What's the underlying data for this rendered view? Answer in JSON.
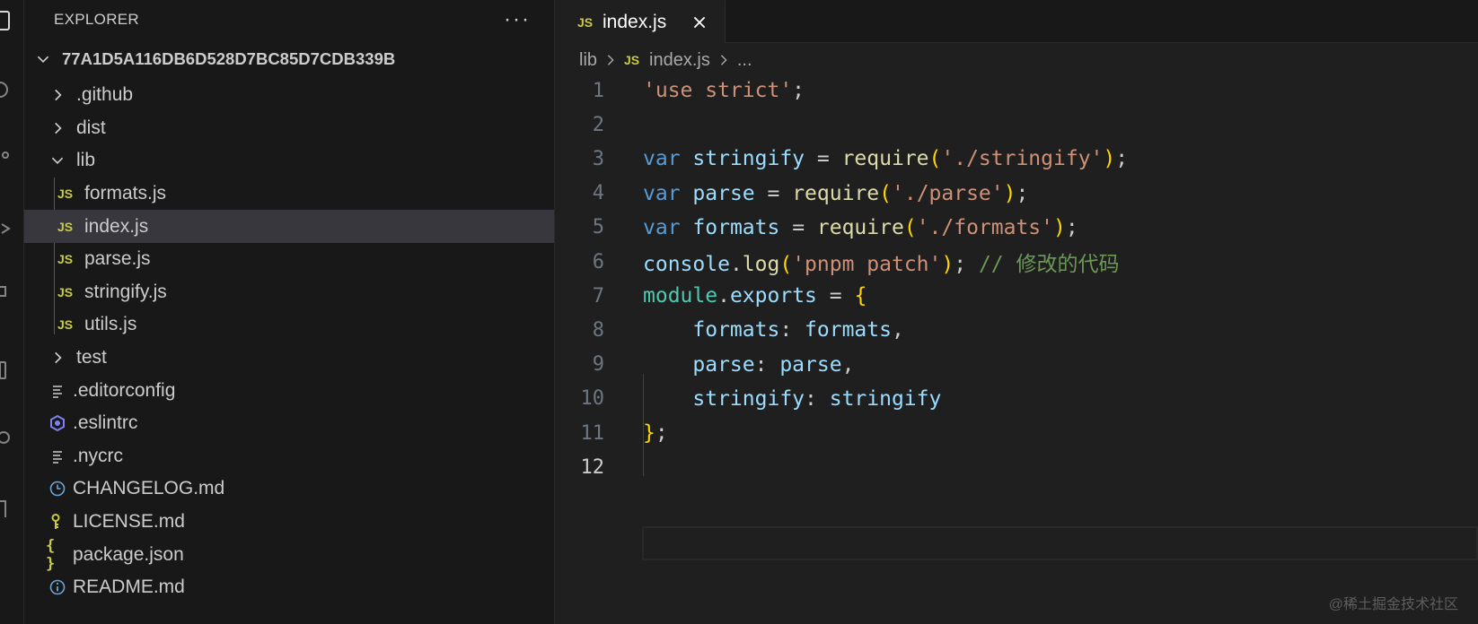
{
  "activity_bar": {
    "icons": [
      "explorer-icon",
      "search-icon",
      "source-control-icon",
      "run-debug-icon",
      "extensions-icon",
      "remote-icon",
      "testing-icon",
      "accounts-icon"
    ]
  },
  "sidebar": {
    "title": "EXPLORER",
    "more_label": "···",
    "root_folder": "77A1D5A116DB6D528D7BC85D7CDB339B",
    "items": [
      {
        "label": ".github",
        "kind": "folder",
        "expanded": false
      },
      {
        "label": "dist",
        "kind": "folder",
        "expanded": false
      },
      {
        "label": "lib",
        "kind": "folder",
        "expanded": true
      },
      {
        "label": "formats.js",
        "kind": "js",
        "js_badge": "JS"
      },
      {
        "label": "index.js",
        "kind": "js",
        "js_badge": "JS",
        "selected": true
      },
      {
        "label": "parse.js",
        "kind": "js",
        "js_badge": "JS"
      },
      {
        "label": "stringify.js",
        "kind": "js",
        "js_badge": "JS"
      },
      {
        "label": "utils.js",
        "kind": "js",
        "js_badge": "JS"
      },
      {
        "label": "test",
        "kind": "folder",
        "expanded": false
      },
      {
        "label": ".editorconfig",
        "kind": "lines-icon"
      },
      {
        "label": ".eslintrc",
        "kind": "eslint-icon"
      },
      {
        "label": ".nycrc",
        "kind": "lines-icon"
      },
      {
        "label": "CHANGELOG.md",
        "kind": "clock-icon"
      },
      {
        "label": "LICENSE.md",
        "kind": "key-icon"
      },
      {
        "label": "package.json",
        "kind": "json-icon",
        "badge": "{ }"
      },
      {
        "label": "README.md",
        "kind": "info-icon"
      }
    ]
  },
  "tab": {
    "js_badge": "JS",
    "label": "index.js"
  },
  "breadcrumb": {
    "folder": "lib",
    "js_badge": "JS",
    "file": "index.js",
    "more": "..."
  },
  "editor": {
    "line_numbers": [
      "1",
      "2",
      "3",
      "4",
      "5",
      "6",
      "7",
      "8",
      "9",
      "10",
      "11",
      "12"
    ],
    "active_line": "12",
    "lines": [
      [
        {
          "t": "'use strict'",
          "c": "str"
        },
        {
          "t": ";",
          "c": "pun"
        }
      ],
      [],
      [
        {
          "t": "var",
          "c": "kw"
        },
        {
          "t": " ",
          "c": "pun"
        },
        {
          "t": "stringify",
          "c": "var"
        },
        {
          "t": " = ",
          "c": "pun"
        },
        {
          "t": "require",
          "c": "fn"
        },
        {
          "t": "(",
          "c": "brk"
        },
        {
          "t": "'./stringify'",
          "c": "str"
        },
        {
          "t": ")",
          "c": "brk"
        },
        {
          "t": ";",
          "c": "pun"
        }
      ],
      [
        {
          "t": "var",
          "c": "kw"
        },
        {
          "t": " ",
          "c": "pun"
        },
        {
          "t": "parse",
          "c": "var"
        },
        {
          "t": " = ",
          "c": "pun"
        },
        {
          "t": "require",
          "c": "fn"
        },
        {
          "t": "(",
          "c": "brk"
        },
        {
          "t": "'./parse'",
          "c": "str"
        },
        {
          "t": ")",
          "c": "brk"
        },
        {
          "t": ";",
          "c": "pun"
        }
      ],
      [
        {
          "t": "var",
          "c": "kw"
        },
        {
          "t": " ",
          "c": "pun"
        },
        {
          "t": "formats",
          "c": "var"
        },
        {
          "t": " = ",
          "c": "pun"
        },
        {
          "t": "require",
          "c": "fn"
        },
        {
          "t": "(",
          "c": "brk"
        },
        {
          "t": "'./formats'",
          "c": "str"
        },
        {
          "t": ")",
          "c": "brk"
        },
        {
          "t": ";",
          "c": "pun"
        }
      ],
      [
        {
          "t": "console",
          "c": "var"
        },
        {
          "t": ".",
          "c": "pun"
        },
        {
          "t": "log",
          "c": "fn"
        },
        {
          "t": "(",
          "c": "brk"
        },
        {
          "t": "'pnpm patch'",
          "c": "str"
        },
        {
          "t": ")",
          "c": "brk"
        },
        {
          "t": "; ",
          "c": "pun"
        },
        {
          "t": "// 修改的代码",
          "c": "cmt"
        }
      ],
      [
        {
          "t": "module",
          "c": "cls"
        },
        {
          "t": ".",
          "c": "pun"
        },
        {
          "t": "exports",
          "c": "var"
        },
        {
          "t": " = ",
          "c": "pun"
        },
        {
          "t": "{",
          "c": "brk"
        }
      ],
      [
        {
          "t": "    formats",
          "c": "var"
        },
        {
          "t": ": ",
          "c": "pun"
        },
        {
          "t": "formats",
          "c": "var"
        },
        {
          "t": ",",
          "c": "pun"
        }
      ],
      [
        {
          "t": "    parse",
          "c": "var"
        },
        {
          "t": ": ",
          "c": "pun"
        },
        {
          "t": "parse",
          "c": "var"
        },
        {
          "t": ",",
          "c": "pun"
        }
      ],
      [
        {
          "t": "    stringify",
          "c": "var"
        },
        {
          "t": ": ",
          "c": "pun"
        },
        {
          "t": "stringify",
          "c": "var"
        }
      ],
      [
        {
          "t": "}",
          "c": "brk"
        },
        {
          "t": ";",
          "c": "pun"
        }
      ],
      []
    ]
  },
  "watermark": "@稀土掘金技术社区",
  "colors": {
    "editor_bg": "#1f1f1f",
    "sidebar_bg": "#181818",
    "selection_bg": "#37373d",
    "js_badge": "#cbcb41",
    "keyword": "#569cd6",
    "variable": "#9cdcfe",
    "function": "#dcdcaa",
    "string": "#ce9178",
    "comment": "#6a9955",
    "bracket": "#ffd700",
    "class": "#4ec9b0"
  }
}
